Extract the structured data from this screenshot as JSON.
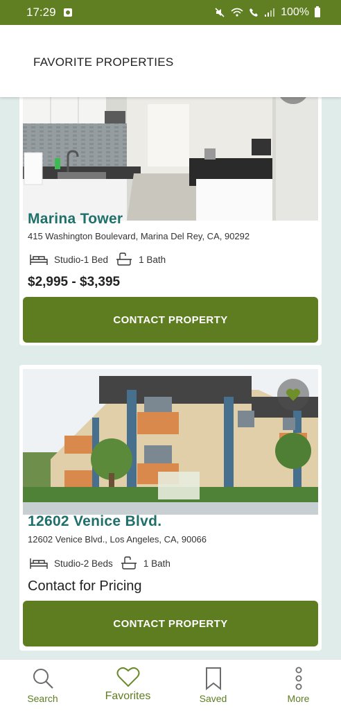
{
  "status_bar": {
    "time": "17:29",
    "battery": "100%"
  },
  "header": {
    "title": "FAVORITE PROPERTIES"
  },
  "properties": [
    {
      "name": "Marina Tower",
      "address": "415 Washington Boulevard, Marina Del Rey, CA, 90292",
      "beds": "Studio-1 Bed",
      "baths": "1 Bath",
      "price": "$2,995 - $3,395",
      "cta": "CONTACT PROPERTY",
      "image": "kitchen-interior-photo"
    },
    {
      "name": "12602 Venice Blvd.",
      "address": "12602 Venice Blvd., Los Angeles, CA, 90066",
      "beds": "Studio-2 Beds",
      "baths": "1 Bath",
      "price": "Contact for Pricing",
      "cta": "CONTACT PROPERTY",
      "image": "apartment-building-photo"
    }
  ],
  "nav": [
    {
      "label": "Search",
      "icon": "search-icon"
    },
    {
      "label": "Favorites",
      "icon": "heart-icon",
      "active": true
    },
    {
      "label": "Saved",
      "icon": "bookmark-icon"
    },
    {
      "label": "More",
      "icon": "more-vertical-icon"
    }
  ],
  "colors": {
    "brand_green": "#5e7c20",
    "status_bar": "#5f7f22",
    "title_teal": "#1f6f6b",
    "background": "#dfecea"
  }
}
